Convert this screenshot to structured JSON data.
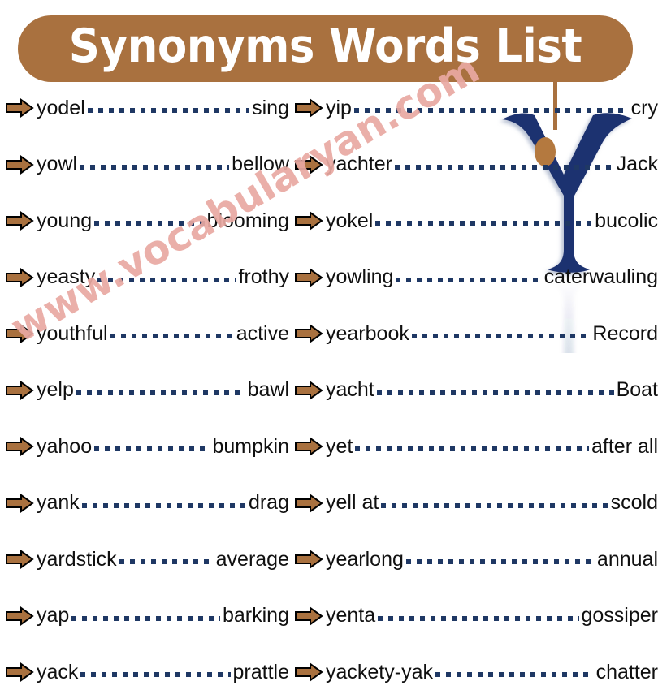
{
  "header": {
    "title": "Synonyms Words List",
    "pill_color": "#A9713F",
    "title_color": "#FFFFFF"
  },
  "decoration": {
    "letter": "Y",
    "letter_color": "#1F3070",
    "accent_dot_color": "#B4793F",
    "connector_color": "#A9713F"
  },
  "watermark": {
    "text": "www.vocabularyan.com",
    "color": "#E9A9A2"
  },
  "style": {
    "leader_dot_color": "#1F3864",
    "arrow_fill": "#A9713F",
    "arrow_stroke": "#000000",
    "text_color": "#101010"
  },
  "columns": {
    "left": [
      {
        "word": "yodel",
        "synonym": "sing"
      },
      {
        "word": "yowl",
        "synonym": "bellow"
      },
      {
        "word": "young",
        "synonym": "blooming"
      },
      {
        "word": "yeasty",
        "synonym": "frothy"
      },
      {
        "word": "youthful",
        "synonym": "active"
      },
      {
        "word": "yelp",
        "synonym": "bawl"
      },
      {
        "word": "yahoo",
        "synonym": "bumpkin"
      },
      {
        "word": "yank",
        "synonym": "drag"
      },
      {
        "word": "yardstick",
        "synonym": "average"
      },
      {
        "word": "yap",
        "synonym": "barking"
      },
      {
        "word": "yack",
        "synonym": "prattle"
      }
    ],
    "right": [
      {
        "word": "yackety-yak",
        "synonym": "chatter"
      },
      {
        "word": "yip",
        "synonym": "cry"
      },
      {
        "word": "yachter",
        "synonym": "Jack"
      },
      {
        "word": "yokel",
        "synonym": "bucolic"
      },
      {
        "word": "yowling",
        "synonym": "caterwauling"
      },
      {
        "word": "yearbook",
        "synonym": "Record"
      },
      {
        "word": "yacht",
        "synonym": "Boat"
      },
      {
        "word": "yet",
        "synonym": "after all"
      },
      {
        "word": "yell at",
        "synonym": "scold"
      },
      {
        "word": "yearlong",
        "synonym": "annual"
      },
      {
        "word": "yenta",
        "synonym": "gossiper"
      }
    ]
  }
}
